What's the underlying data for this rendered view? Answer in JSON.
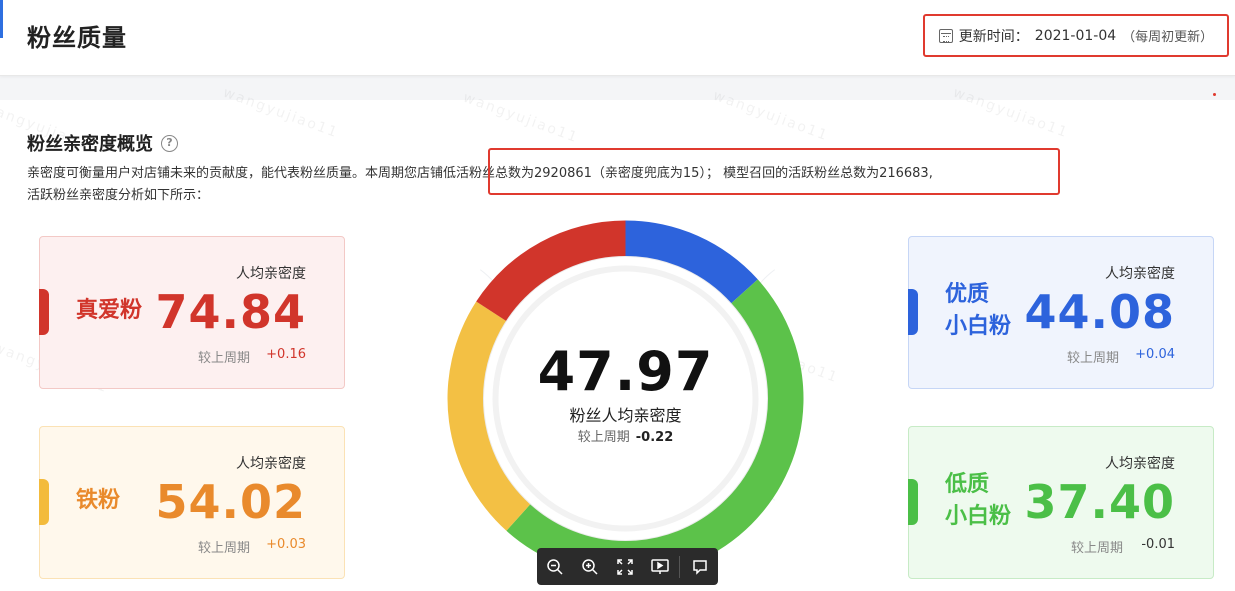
{
  "header": {
    "title": "粉丝质量",
    "update_label": "更新时间：",
    "update_value": "2021-01-04",
    "update_note": "（每周初更新）"
  },
  "section": {
    "title": "粉丝亲密度概览",
    "help_icon": "question-circle-icon",
    "desc_line1": "亲密度可衡量用户对店铺未来的贡献度，能代表粉丝质量。本周期您店铺低活粉丝总数为2920861（亲密度兜底为15）；  模型召回的活跃粉丝总数为216683,",
    "desc_line2": "活跃粉丝亲密度分析如下所示："
  },
  "center": {
    "value": "47.97",
    "label": "粉丝人均亲密度",
    "cmp_label": "较上周期",
    "cmp_value": "-0.22"
  },
  "cards": {
    "true_love": {
      "name": "真爱粉",
      "avg_label": "人均亲密度",
      "value": "74.84",
      "cmp_label": "较上周期",
      "cmp_value": "+0.16",
      "color": "#d1352b"
    },
    "iron": {
      "name": "铁粉",
      "avg_label": "人均亲密度",
      "value": "54.02",
      "cmp_label": "较上周期",
      "cmp_value": "+0.03",
      "color": "#e98a2c"
    },
    "quality_line1": "优质",
    "quality_line2": "小白粉",
    "quality": {
      "avg_label": "人均亲密度",
      "value": "44.08",
      "cmp_label": "较上周期",
      "cmp_value": "+0.04",
      "color": "#2d63dc"
    },
    "low_line1": "低质",
    "low_line2": "小白粉",
    "low": {
      "avg_label": "人均亲密度",
      "value": "37.40",
      "cmp_label": "较上周期",
      "cmp_value": "-0.01",
      "color": "#4bbf47"
    }
  },
  "watermark": "wangyujiao11",
  "toolbar": {
    "icons": [
      "zoom-out-icon",
      "zoom-in-icon",
      "fullscreen-icon",
      "slideshow-icon",
      "comment-icon"
    ]
  },
  "colors": {
    "red": "#d1352b",
    "blue": "#2d63dc",
    "green": "#5cc24a",
    "yellow": "#f3c044",
    "highlight": "#e03a2f"
  }
}
